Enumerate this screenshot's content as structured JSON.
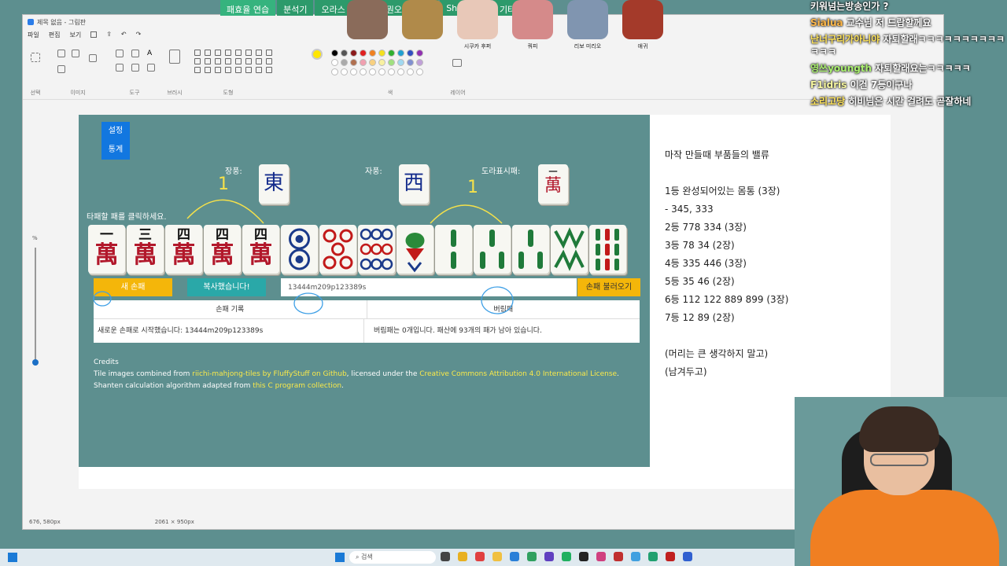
{
  "stream_tabs": [
    "패효율 연습",
    "분석기",
    "오라스 연습",
    "빠뭔오리",
    "타",
    "Shanta@",
    "기타 도구"
  ],
  "paint": {
    "title": "제목 없음 - 그림판",
    "menu": [
      "파일",
      "편집",
      "보기"
    ],
    "groups": [
      "선택",
      "이미지",
      "도구",
      "브러시",
      "도형",
      "색",
      "레이어"
    ],
    "status_pos": "676, 580px",
    "status_size": "2061 × 950px"
  },
  "emotes": [
    "",
    "",
    "시쿠카 후퍼",
    "쿼피",
    "리보 미리오",
    "애귀"
  ],
  "game": {
    "side_buttons": [
      "설정",
      "통계"
    ],
    "round_wind_label": "장풍:",
    "seat_wind_label": "자풍:",
    "dora_label": "도라표시패:",
    "click_hint": "타패할 패를 클릭하세요.",
    "new_hand_button": "새 손패",
    "copy_button": "복사했습니다!",
    "code_value": "13444m209p123389s",
    "load_button": "손패 불러오기",
    "log_head_left": "손패 기록",
    "log_head_right": "버림패",
    "log_left": "새로운 손패로 시작했습니다: 13444m209p123389s",
    "log_right": "버림패는 0개입니다. 패산에 93개의 패가 남아 있습니다.",
    "credits_title": "Credits",
    "credits_l1a": "Tile images combined from ",
    "credits_l1b": "riichi-mahjong-tiles by FluffyStuff on Github",
    "credits_l1c": ", licensed under the ",
    "credits_l1d": "Creative Commons Attribution 4.0 International License",
    "credits_l1e": ".",
    "credits_l2a": "Shanten calculation algorithm adapted from ",
    "credits_l2b": "this C program collection",
    "credits_l2c": ".",
    "round_wind_tile": "東",
    "seat_wind_tile": "西",
    "dora_tile_top": "一",
    "dora_tile_bottom": "萬",
    "man_suit": "萬",
    "man_ranks": [
      "一",
      "三",
      "四",
      "四",
      "四"
    ],
    "pin_tiles": [
      "⦿",
      "⦿",
      "⦿"
    ],
    "sou_tiles": [
      "❀",
      "‖",
      "‖",
      "‖",
      "Ж",
      "‖"
    ]
  },
  "annotations": {
    "num_left": "1",
    "num_right": "1"
  },
  "notes": [
    "마작 만들때 부품들의 밸류",
    "",
    "1등 완성되어있는 몸통 (3장)",
    " - 345, 333",
    "2등 778 334 (3장)",
    "3등 78 34 (2장)",
    "4등 335 446 (3장)",
    "5등 35 46 (2장)",
    "6등 112 122 889 899 (3장)",
    "7등 12 89 (2장)",
    "",
    "(머리는 큰 생각하지 말고)",
    "(남겨두고)"
  ],
  "chat": [
    {
      "nick": "",
      "msg": "키워넘는방송인가 ?"
    },
    {
      "nick": "Sialua",
      "msg": " 교수님 저 드랍할께요"
    },
    {
      "nick": "난너구리가아니야",
      "msg": " 자퇴할래ㅋㅋㅋㅋㅋㅋㅋㅋㅋㅋㅋㅋㅋ"
    },
    {
      "nick": "영쓰youngth",
      "msg": " 자퇴할래요는ㅋㅋㅋㅋㅋ"
    },
    {
      "nick": "F1idris",
      "msg": " 이건 7등이구나"
    },
    {
      "nick": "소리고당",
      "msg": " 히비님은 시간 걸려도 곧잘하네"
    }
  ],
  "taskbar": {
    "search_placeholder": "검색"
  },
  "colors": {
    "game_bg": "#5d8f8f",
    "accent_blue": "#1277e0",
    "accent_yellow": "#f4b60a",
    "accent_teal": "#2aa8a8"
  }
}
